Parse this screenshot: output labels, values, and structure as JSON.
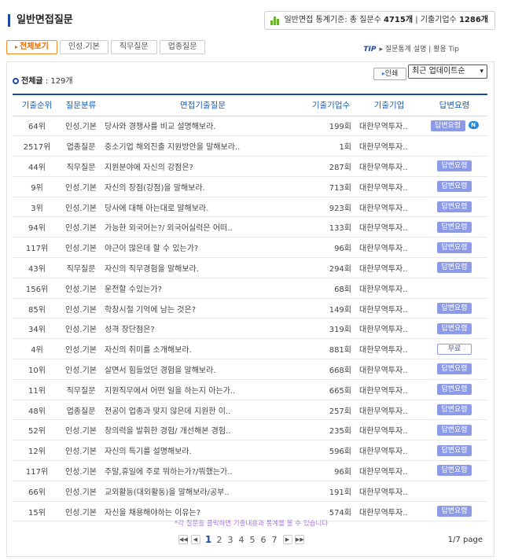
{
  "header": {
    "title": "일반면접질문",
    "stats_prefix": "일반면접 통계기준: 총 질문수",
    "question_count": "4715개",
    "stats_separator": " | 기출기업수",
    "company_count": "1286개"
  },
  "tabs": [
    "전체보기",
    "인성.기본",
    "직무질문",
    "업종질문"
  ],
  "tip": {
    "label": "TIP",
    "text": "질문통계 설명 | 활용 Tip"
  },
  "total": {
    "label": "전체글",
    "count": " : 129개"
  },
  "print_label": "인쇄",
  "sort": {
    "selected": "최근 업데이트순",
    "arrow": "▾"
  },
  "columns": [
    "기출순위",
    "질문분류",
    "면접기출질문",
    "기출기업수",
    "기출기업",
    "답변요령"
  ],
  "answer_label": "답변요령",
  "free_label": "무료",
  "new_badge": "N",
  "rows": [
    {
      "rank": "64위",
      "cat": "인성.기본",
      "q": "당사와 경쟁사를 비교 설명해보라.",
      "cnt": "199회",
      "co": "대한무역투자..",
      "ans": "answer",
      "isnew": true
    },
    {
      "rank": "2517위",
      "cat": "업종질문",
      "q": "중소기업 해외진출 지원방안을 말해보라..",
      "cnt": "1회",
      "co": "대한무역투자..",
      "ans": "none"
    },
    {
      "rank": "44위",
      "cat": "직무질문",
      "q": "지원분야에 자신의 강점은?",
      "cnt": "287회",
      "co": "대한무역투자..",
      "ans": "answer"
    },
    {
      "rank": "9위",
      "cat": "인성.기본",
      "q": "자신의 장점(강점)을 말해보라.",
      "cnt": "713회",
      "co": "대한무역투자..",
      "ans": "answer"
    },
    {
      "rank": "3위",
      "cat": "인성.기본",
      "q": "당사에 대해 아는대로 말해보라.",
      "cnt": "923회",
      "co": "대한무역투자..",
      "ans": "answer"
    },
    {
      "rank": "94위",
      "cat": "인성.기본",
      "q": "가능한 외국어는?/ 외국어실력은 어떠..",
      "cnt": "133회",
      "co": "대한무역투자..",
      "ans": "answer"
    },
    {
      "rank": "117위",
      "cat": "인성.기본",
      "q": "야근이 많은데 할 수 있는가?",
      "cnt": "96회",
      "co": "대한무역투자..",
      "ans": "answer"
    },
    {
      "rank": "43위",
      "cat": "직무질문",
      "q": "자신의 직무경험을 말해보라.",
      "cnt": "294회",
      "co": "대한무역투자..",
      "ans": "answer"
    },
    {
      "rank": "156위",
      "cat": "인성.기본",
      "q": "운전할 수있는가?",
      "cnt": "68회",
      "co": "대한무역투자..",
      "ans": "none"
    },
    {
      "rank": "85위",
      "cat": "인성.기본",
      "q": "학창시절 기억에 남는 것은?",
      "cnt": "149회",
      "co": "대한무역투자..",
      "ans": "answer"
    },
    {
      "rank": "34위",
      "cat": "인성.기본",
      "q": "성격 장단점은?",
      "cnt": "319회",
      "co": "대한무역투자..",
      "ans": "answer"
    },
    {
      "rank": "4위",
      "cat": "인성.기본",
      "q": "자신의 취미를 소개해보라.",
      "cnt": "881회",
      "co": "대한무역투자..",
      "ans": "free"
    },
    {
      "rank": "10위",
      "cat": "인성.기본",
      "q": "살면서 힘들었던 경험을 말해보라.",
      "cnt": "668회",
      "co": "대한무역투자..",
      "ans": "answer"
    },
    {
      "rank": "11위",
      "cat": "직무질문",
      "q": "지원직무에서 어떤 일을 하는지 아는가..",
      "cnt": "665회",
      "co": "대한무역투자..",
      "ans": "answer"
    },
    {
      "rank": "48위",
      "cat": "업종질문",
      "q": "전공이 업종과 맞지 않은데 지원한 이..",
      "cnt": "257회",
      "co": "대한무역투자..",
      "ans": "answer"
    },
    {
      "rank": "52위",
      "cat": "인성.기본",
      "q": "창의력을 발휘한 경험/ 개선해본 경험..",
      "cnt": "235회",
      "co": "대한무역투자..",
      "ans": "answer"
    },
    {
      "rank": "12위",
      "cat": "인성.기본",
      "q": "자신의 특기를 설명해보라.",
      "cnt": "596회",
      "co": "대한무역투자..",
      "ans": "answer"
    },
    {
      "rank": "117위",
      "cat": "인성.기본",
      "q": "주말,휴일에 주로 뭐하는가?/뭐했는가..",
      "cnt": "96회",
      "co": "대한무역투자..",
      "ans": "answer"
    },
    {
      "rank": "66위",
      "cat": "인성.기본",
      "q": "교외활동(대외활동)을 말해보라/공부..",
      "cnt": "191회",
      "co": "대한무역투자..",
      "ans": "none"
    },
    {
      "rank": "15위",
      "cat": "인성.기본",
      "q": "자신을 채용해야하는 이유는?",
      "cnt": "574회",
      "co": "대한무역투자..",
      "ans": "answer"
    }
  ],
  "note": "*각 질문을 클릭하면 기출내용과 통계를 볼 수 있습니다",
  "pagination": {
    "first": "◀◀",
    "prev": "◀",
    "next": "▶",
    "last": "▶▶",
    "pages": [
      "1",
      "2",
      "3",
      "4",
      "5",
      "6",
      "7"
    ],
    "current": "1",
    "info": "1/7 page"
  }
}
